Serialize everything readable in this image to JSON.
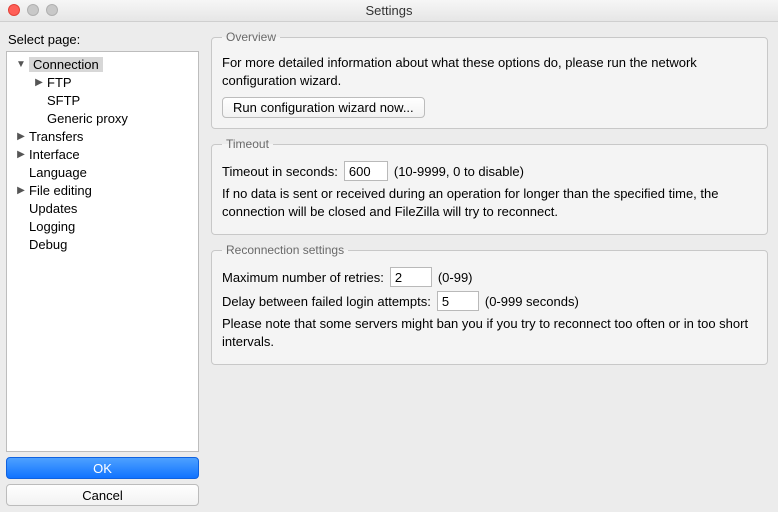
{
  "window": {
    "title": "Settings"
  },
  "sidebar": {
    "label": "Select page:",
    "items": [
      {
        "label": "Connection",
        "depth": 0,
        "arrow": "down",
        "selected": true
      },
      {
        "label": "FTP",
        "depth": 1,
        "arrow": "right"
      },
      {
        "label": "SFTP",
        "depth": 1,
        "arrow": "none"
      },
      {
        "label": "Generic proxy",
        "depth": 1,
        "arrow": "none"
      },
      {
        "label": "Transfers",
        "depth": 0,
        "arrow": "right"
      },
      {
        "label": "Interface",
        "depth": 0,
        "arrow": "right"
      },
      {
        "label": "Language",
        "depth": 0,
        "arrow": "none"
      },
      {
        "label": "File editing",
        "depth": 0,
        "arrow": "right"
      },
      {
        "label": "Updates",
        "depth": 0,
        "arrow": "none"
      },
      {
        "label": "Logging",
        "depth": 0,
        "arrow": "none"
      },
      {
        "label": "Debug",
        "depth": 0,
        "arrow": "none"
      }
    ],
    "ok": "OK",
    "cancel": "Cancel"
  },
  "overview": {
    "legend": "Overview",
    "text": "For more detailed information about what these options do, please run the network configuration wizard.",
    "button": "Run configuration wizard now..."
  },
  "timeout": {
    "legend": "Timeout",
    "label": "Timeout in seconds:",
    "value": "600",
    "hint": "(10-9999, 0 to disable)",
    "desc": "If no data is sent or received during an operation for longer than the specified time, the connection will be closed and FileZilla will try to reconnect."
  },
  "reconnect": {
    "legend": "Reconnection settings",
    "retries_label": "Maximum number of retries:",
    "retries_value": "2",
    "retries_hint": "(0-99)",
    "delay_label": "Delay between failed login attempts:",
    "delay_value": "5",
    "delay_hint": "(0-999 seconds)",
    "note": "Please note that some servers might ban you if you try to reconnect too often or in too short intervals."
  }
}
